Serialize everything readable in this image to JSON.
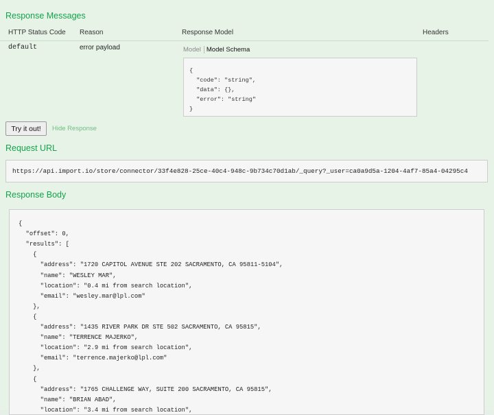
{
  "response_messages": {
    "title": "Response Messages",
    "headers": {
      "status_code": "HTTP Status Code",
      "reason": "Reason",
      "response_model": "Response Model",
      "headers": "Headers"
    },
    "row": {
      "status_code": "default",
      "reason": "error payload"
    },
    "model_tabs": {
      "model": "Model",
      "schema": "Model Schema"
    },
    "schema_lines": [
      "{",
      "  \"code\": \"string\",",
      "  \"data\": {},",
      "  \"error\": \"string\"",
      "}"
    ]
  },
  "actions": {
    "try_it_out": "Try it out!",
    "hide_response": "Hide Response"
  },
  "request_url": {
    "title": "Request URL",
    "value": "https://api.import.io/store/connector/33f4e828-25ce-40c4-948c-9b734c70d1ab/_query?_user=ca0a9d5a-1204-4af7-85a4-04295c4"
  },
  "response_body": {
    "title": "Response Body",
    "lines": [
      "{",
      "  \"offset\": 0,",
      "  \"results\": [",
      "    {",
      "      \"address\": \"1720 CAPITOL AVENUE STE 202 SACRAMENTO, CA 95811-5104\",",
      "      \"name\": \"WESLEY MAR\",",
      "      \"location\": \"0.4 mi from search location\",",
      "      \"email\": \"wesley.mar@lpl.com\"",
      "    },",
      "    {",
      "      \"address\": \"1435 RIVER PARK DR STE 502 SACRAMENTO, CA 95815\",",
      "      \"name\": \"TERRENCE MAJERKO\",",
      "      \"location\": \"2.9 mi from search location\",",
      "      \"email\": \"terrence.majerko@lpl.com\"",
      "    },",
      "    {",
      "      \"address\": \"1765 CHALLENGE WAY, SUITE 200 SACRAMENTO, CA 95815\",",
      "      \"name\": \"BRIAN ABAD\",",
      "      \"location\": \"3.4 mi from search location\","
    ]
  },
  "colors": {
    "background": "#e8f3e8",
    "heading": "#10a54a",
    "link": "#6fbd84",
    "code_box": "#f6f6f6"
  }
}
